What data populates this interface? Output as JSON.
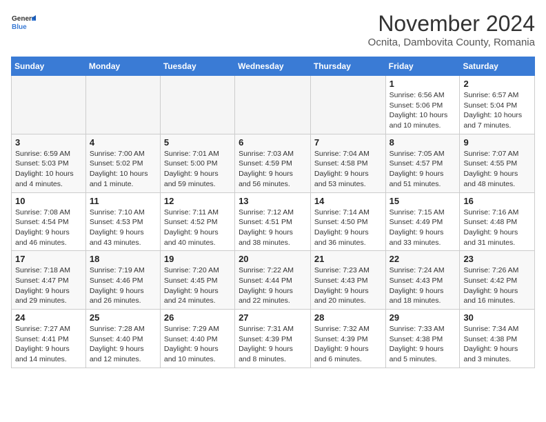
{
  "header": {
    "logo_general": "General",
    "logo_blue": "Blue",
    "month_title": "November 2024",
    "location": "Ocnita, Dambovita County, Romania"
  },
  "days_of_week": [
    "Sunday",
    "Monday",
    "Tuesday",
    "Wednesday",
    "Thursday",
    "Friday",
    "Saturday"
  ],
  "weeks": [
    {
      "days": [
        {
          "date": "",
          "info": "",
          "empty": true
        },
        {
          "date": "",
          "info": "",
          "empty": true
        },
        {
          "date": "",
          "info": "",
          "empty": true
        },
        {
          "date": "",
          "info": "",
          "empty": true
        },
        {
          "date": "",
          "info": "",
          "empty": true
        },
        {
          "date": "1",
          "info": "Sunrise: 6:56 AM\nSunset: 5:06 PM\nDaylight: 10 hours and 10 minutes."
        },
        {
          "date": "2",
          "info": "Sunrise: 6:57 AM\nSunset: 5:04 PM\nDaylight: 10 hours and 7 minutes."
        }
      ]
    },
    {
      "days": [
        {
          "date": "3",
          "info": "Sunrise: 6:59 AM\nSunset: 5:03 PM\nDaylight: 10 hours and 4 minutes."
        },
        {
          "date": "4",
          "info": "Sunrise: 7:00 AM\nSunset: 5:02 PM\nDaylight: 10 hours and 1 minute."
        },
        {
          "date": "5",
          "info": "Sunrise: 7:01 AM\nSunset: 5:00 PM\nDaylight: 9 hours and 59 minutes."
        },
        {
          "date": "6",
          "info": "Sunrise: 7:03 AM\nSunset: 4:59 PM\nDaylight: 9 hours and 56 minutes."
        },
        {
          "date": "7",
          "info": "Sunrise: 7:04 AM\nSunset: 4:58 PM\nDaylight: 9 hours and 53 minutes."
        },
        {
          "date": "8",
          "info": "Sunrise: 7:05 AM\nSunset: 4:57 PM\nDaylight: 9 hours and 51 minutes."
        },
        {
          "date": "9",
          "info": "Sunrise: 7:07 AM\nSunset: 4:55 PM\nDaylight: 9 hours and 48 minutes."
        }
      ]
    },
    {
      "days": [
        {
          "date": "10",
          "info": "Sunrise: 7:08 AM\nSunset: 4:54 PM\nDaylight: 9 hours and 46 minutes."
        },
        {
          "date": "11",
          "info": "Sunrise: 7:10 AM\nSunset: 4:53 PM\nDaylight: 9 hours and 43 minutes."
        },
        {
          "date": "12",
          "info": "Sunrise: 7:11 AM\nSunset: 4:52 PM\nDaylight: 9 hours and 40 minutes."
        },
        {
          "date": "13",
          "info": "Sunrise: 7:12 AM\nSunset: 4:51 PM\nDaylight: 9 hours and 38 minutes."
        },
        {
          "date": "14",
          "info": "Sunrise: 7:14 AM\nSunset: 4:50 PM\nDaylight: 9 hours and 36 minutes."
        },
        {
          "date": "15",
          "info": "Sunrise: 7:15 AM\nSunset: 4:49 PM\nDaylight: 9 hours and 33 minutes."
        },
        {
          "date": "16",
          "info": "Sunrise: 7:16 AM\nSunset: 4:48 PM\nDaylight: 9 hours and 31 minutes."
        }
      ]
    },
    {
      "days": [
        {
          "date": "17",
          "info": "Sunrise: 7:18 AM\nSunset: 4:47 PM\nDaylight: 9 hours and 29 minutes."
        },
        {
          "date": "18",
          "info": "Sunrise: 7:19 AM\nSunset: 4:46 PM\nDaylight: 9 hours and 26 minutes."
        },
        {
          "date": "19",
          "info": "Sunrise: 7:20 AM\nSunset: 4:45 PM\nDaylight: 9 hours and 24 minutes."
        },
        {
          "date": "20",
          "info": "Sunrise: 7:22 AM\nSunset: 4:44 PM\nDaylight: 9 hours and 22 minutes."
        },
        {
          "date": "21",
          "info": "Sunrise: 7:23 AM\nSunset: 4:43 PM\nDaylight: 9 hours and 20 minutes."
        },
        {
          "date": "22",
          "info": "Sunrise: 7:24 AM\nSunset: 4:43 PM\nDaylight: 9 hours and 18 minutes."
        },
        {
          "date": "23",
          "info": "Sunrise: 7:26 AM\nSunset: 4:42 PM\nDaylight: 9 hours and 16 minutes."
        }
      ]
    },
    {
      "days": [
        {
          "date": "24",
          "info": "Sunrise: 7:27 AM\nSunset: 4:41 PM\nDaylight: 9 hours and 14 minutes."
        },
        {
          "date": "25",
          "info": "Sunrise: 7:28 AM\nSunset: 4:40 PM\nDaylight: 9 hours and 12 minutes."
        },
        {
          "date": "26",
          "info": "Sunrise: 7:29 AM\nSunset: 4:40 PM\nDaylight: 9 hours and 10 minutes."
        },
        {
          "date": "27",
          "info": "Sunrise: 7:31 AM\nSunset: 4:39 PM\nDaylight: 9 hours and 8 minutes."
        },
        {
          "date": "28",
          "info": "Sunrise: 7:32 AM\nSunset: 4:39 PM\nDaylight: 9 hours and 6 minutes."
        },
        {
          "date": "29",
          "info": "Sunrise: 7:33 AM\nSunset: 4:38 PM\nDaylight: 9 hours and 5 minutes."
        },
        {
          "date": "30",
          "info": "Sunrise: 7:34 AM\nSunset: 4:38 PM\nDaylight: 9 hours and 3 minutes."
        }
      ]
    }
  ]
}
